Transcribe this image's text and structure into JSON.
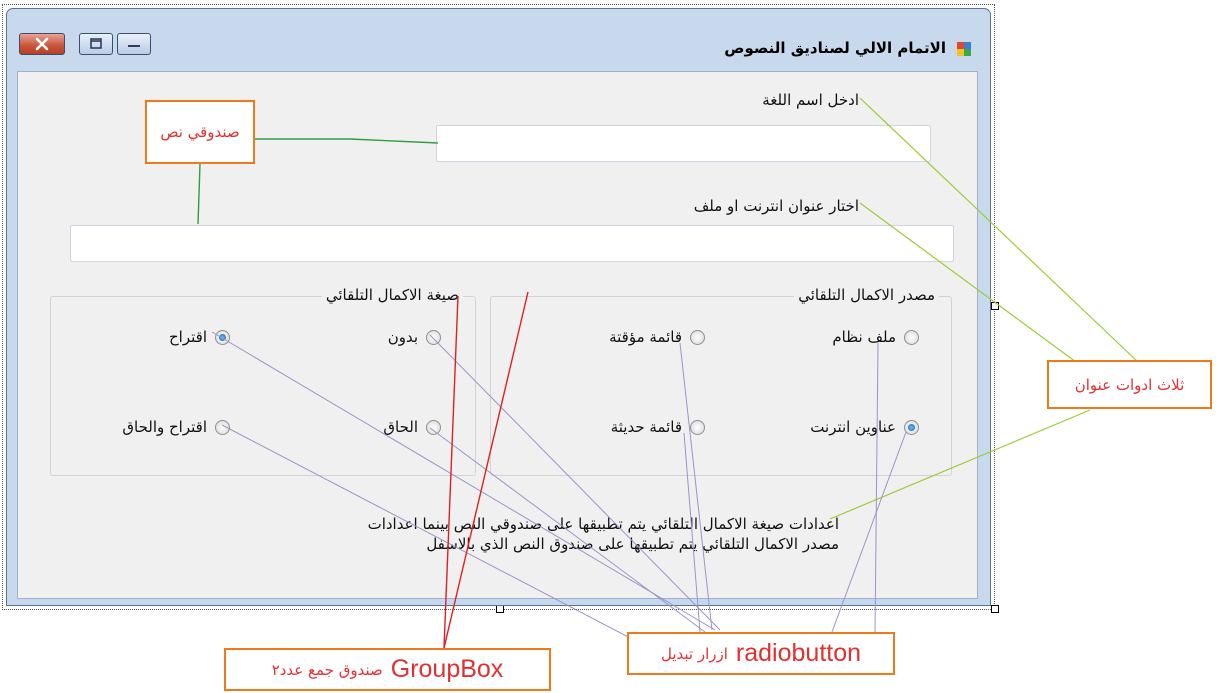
{
  "window": {
    "title": "الاتمام الالي لصناديق النصوص"
  },
  "form": {
    "language_label": "ادخل اسم اللغة",
    "language_value": "",
    "source_label": "اختار عنوان انترنت او ملف",
    "source_value": "",
    "group_source": {
      "title": "مصدر الاكمال التلقائي",
      "options": [
        {
          "label": "ملف نظام",
          "checked": false
        },
        {
          "label": "قائمة مؤقتة",
          "checked": false
        },
        {
          "label": "عناوين انترنت",
          "checked": true
        },
        {
          "label": "قائمة حديثة",
          "checked": false
        }
      ]
    },
    "group_mode": {
      "title": "صيغة الاكمال التلقائي",
      "options": [
        {
          "label": "بدون",
          "checked": false
        },
        {
          "label": "اقتراح",
          "checked": true
        },
        {
          "label": "الحاق",
          "checked": false
        },
        {
          "label": "اقتراح والحاق",
          "checked": false
        }
      ]
    },
    "info_line1": "اعدادات صيغة الاكمال التلقائي يتم تطبيقها على صندوقي النص بينما اعدادات",
    "info_line2": "مصدر الاكمال التلقائي يتم تطبيقها على صندوق النص الذي بالاسفل"
  },
  "annotations": {
    "textbox_callout": "صندوقي نص",
    "label_callout": "ثلاث ادوات عنوان",
    "radio_callout_main": "radiobutton",
    "radio_callout_sub": "ازرار تبديل",
    "group_callout_main": "GroupBox",
    "group_callout_sub": "صندوق جمع عدد٢"
  },
  "colors": {
    "callout_border": "#f07a1a",
    "callout_text": "#e23030",
    "line_green": "#2e9e3e",
    "line_lime": "#9acd32",
    "line_purple": "#9a94c8",
    "line_red": "#e02020"
  }
}
